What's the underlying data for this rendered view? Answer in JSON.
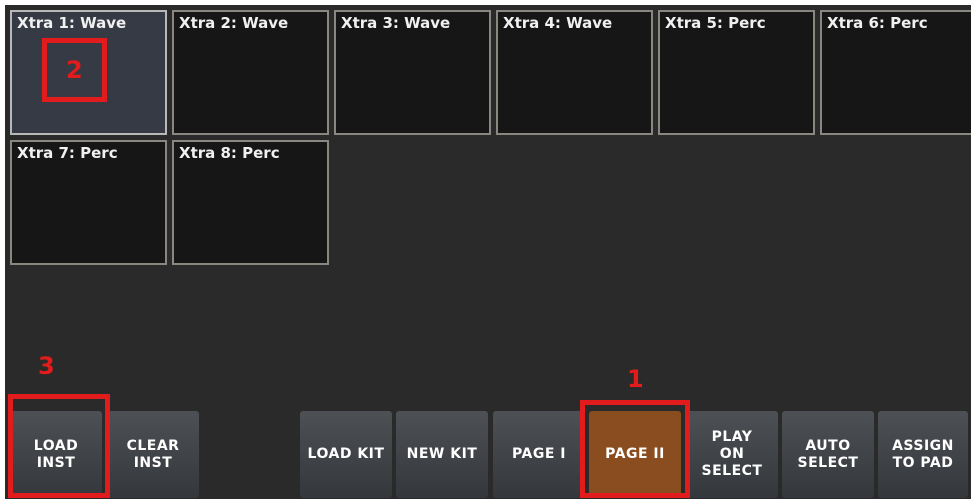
{
  "pads": [
    {
      "label": "Xtra 1: Wave"
    },
    {
      "label": "Xtra 2: Wave"
    },
    {
      "label": "Xtra 3: Wave"
    },
    {
      "label": "Xtra 4: Wave"
    },
    {
      "label": "Xtra 5: Perc"
    },
    {
      "label": "Xtra 6: Perc"
    },
    {
      "label": "Xtra 7: Perc"
    },
    {
      "label": "Xtra 8: Perc"
    }
  ],
  "toolbar": {
    "load_inst": "LOAD\nINST",
    "clear_inst": "CLEAR\nINST",
    "load_kit": "LOAD KIT",
    "new_kit": "NEW KIT",
    "page_1": "PAGE I",
    "page_2": "PAGE II",
    "play_on_select": "PLAY\nON\nSELECT",
    "auto_select": "AUTO\nSELECT",
    "assign_to_pad": "ASSIGN\nTO PAD"
  },
  "annotations": {
    "step_1": "1",
    "step_2": "2",
    "step_3": "3"
  },
  "colors": {
    "annotation_red": "#e21c1c",
    "active_button": "#8a4d1f"
  }
}
